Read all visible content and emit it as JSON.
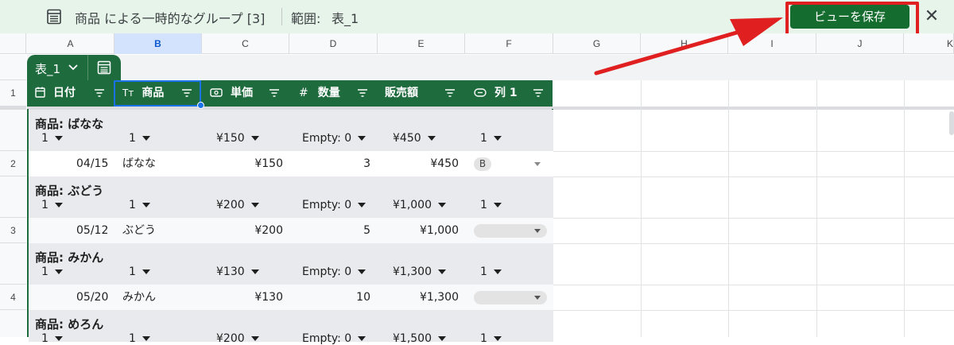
{
  "topbar": {
    "title": "商品 による一時的なグループ [3]",
    "range_label": "範囲:",
    "range_value": "表_1",
    "save_label": "ビューを保存",
    "close_label": "✕"
  },
  "columns": [
    "A",
    "B",
    "C",
    "D",
    "E",
    "F",
    "G",
    "H",
    "I",
    "J",
    "K"
  ],
  "row_numbers": [
    "1",
    "2",
    "3",
    "4"
  ],
  "table": {
    "name": "表_1",
    "headers": [
      {
        "label": "日付",
        "icon": "calendar-icon"
      },
      {
        "label": "商品",
        "icon": "text-type-icon"
      },
      {
        "label": "単価",
        "icon": "currency-icon"
      },
      {
        "label": "数量",
        "icon": "number-icon"
      },
      {
        "label": "販売額",
        "icon": ""
      },
      {
        "label": "列 1",
        "icon": "dropdown-chip-icon"
      }
    ]
  },
  "groups": [
    {
      "title": "商品: ばなな",
      "aggregates": [
        "1",
        "1",
        "¥150",
        "Empty: 0",
        "¥450",
        "1"
      ],
      "row": {
        "date": "04/15",
        "product": "ばなな",
        "price": "¥150",
        "qty": "3",
        "sales": "¥450",
        "col1": "B"
      }
    },
    {
      "title": "商品: ぶどう",
      "aggregates": [
        "1",
        "1",
        "¥200",
        "Empty: 0",
        "¥1,000",
        "1"
      ],
      "row": {
        "date": "05/12",
        "product": "ぶどう",
        "price": "¥200",
        "qty": "5",
        "sales": "¥1,000",
        "col1": ""
      }
    },
    {
      "title": "商品: みかん",
      "aggregates": [
        "1",
        "1",
        "¥130",
        "Empty: 0",
        "¥1,300",
        "1"
      ],
      "row": {
        "date": "05/20",
        "product": "みかん",
        "price": "¥130",
        "qty": "10",
        "sales": "¥1,300",
        "col1": ""
      }
    },
    {
      "title": "商品: めろん",
      "aggregates": [
        "1",
        "1",
        "¥200",
        "Empty: 0",
        "¥1,500",
        "1"
      ]
    }
  ],
  "colors": {
    "table_header": "#1e6b3e",
    "topbar_bg": "#e6f4ea",
    "save_button": "#146c2e",
    "highlight": "#e02020",
    "selection": "#1a73e8"
  }
}
